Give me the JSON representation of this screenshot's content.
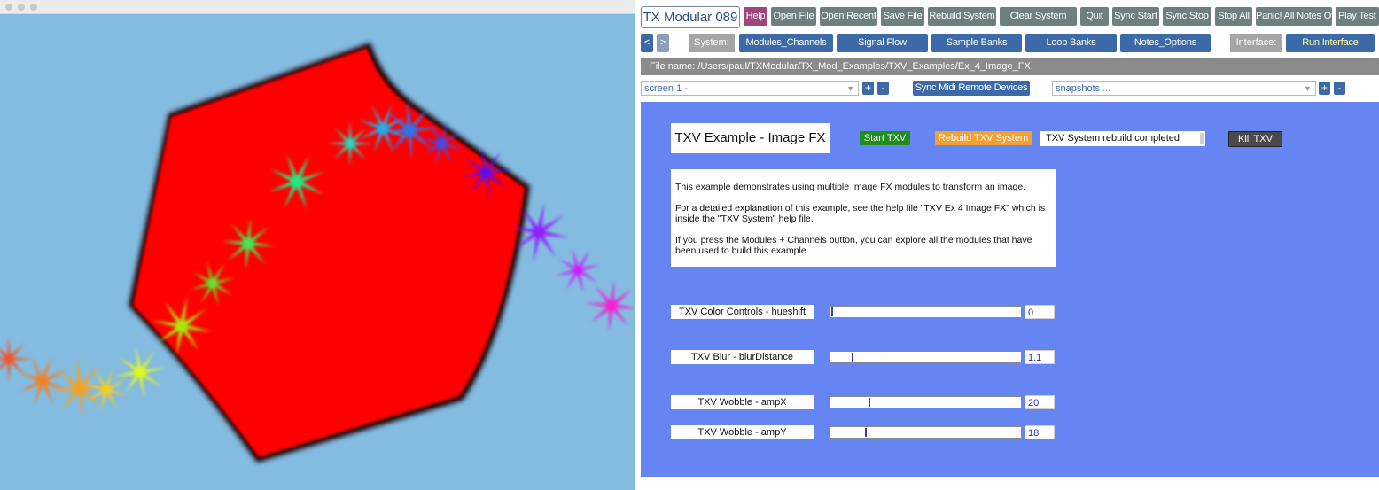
{
  "toolbar": {
    "app_title": "TX Modular 089",
    "buttons": [
      "Help",
      "Open File",
      "Open Recent",
      "Save File",
      "Rebuild System",
      "Clear System",
      "Quit",
      "Sync Start",
      "Sync Stop",
      "Stop All",
      "Panic! All Notes Off",
      "Play Test N"
    ]
  },
  "nav": {
    "back": "<",
    "forward": ">",
    "system_label": "System:",
    "tabs": [
      "Modules_Channels",
      "Signal Flow",
      "Sample Banks",
      "Loop Banks",
      "Notes_Options"
    ],
    "interface_label": "Interface:",
    "run_interface": "Run Interface"
  },
  "file": {
    "text": "File name: /Users/paul/TXModular/TX_Mod_Examples/TXV_Examples/Ex_4_Image_FX"
  },
  "screens": {
    "selected": "screen 1 -",
    "plus": "+",
    "minus": "-",
    "sync_midi": "Sync Midi Remote Devices",
    "snapshots": "snapshots ..."
  },
  "main": {
    "title": "TXV Example - Image FX",
    "start_txv": "Start TXV",
    "rebuild_txv": "Rebuild TXV System",
    "status": "TXV System rebuild completed",
    "kill_txv": "Kill TXV",
    "description": [
      "This example demonstrates using multiple Image FX modules to transform an image.",
      "For a detailed explanation of this example, see the help file \"TXV Ex 4 Image FX\" which is inside the \"TXV System\" help file.",
      "If you press the Modules + Channels button, you can explore all the modules that have been used to build this example."
    ],
    "sliders": [
      {
        "label": "TXV Color Controls - hueshift",
        "value": "0",
        "position": 0.0
      },
      {
        "label": "TXV Blur - blurDistance",
        "value": "1.1",
        "position": 0.11
      },
      {
        "label": "TXV Wobble - ampX",
        "value": "20",
        "position": 0.2
      },
      {
        "label": "TXV Wobble - ampY",
        "value": "18",
        "position": 0.18
      }
    ]
  },
  "colors": {
    "render_bg": "#84bbe1",
    "shape_fill": "#ff0000",
    "panel_blue": "#6585f2",
    "button_grey": "#6e7f80",
    "button_blue": "#3c6aa8",
    "help_pink": "#a0457e",
    "start_green": "#1e8f1e",
    "rebuild_orange": "#f5a030",
    "kill_dark": "#4a4a4a"
  }
}
